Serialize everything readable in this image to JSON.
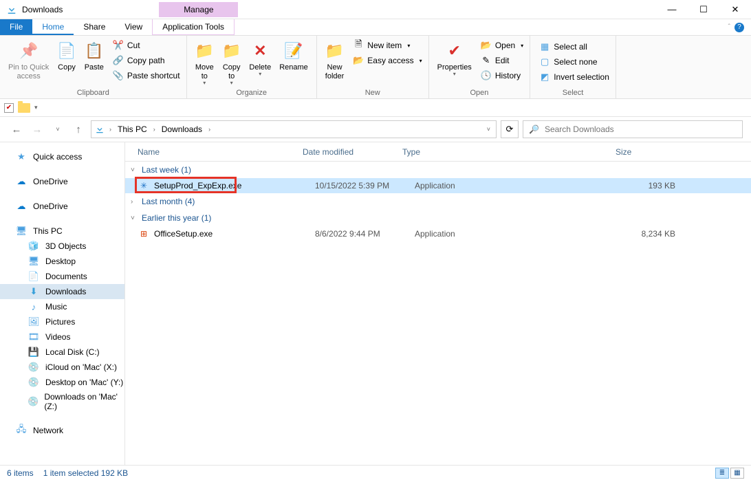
{
  "window": {
    "title": "Downloads",
    "manage_tab": "Manage"
  },
  "menutabs": {
    "file": "File",
    "home": "Home",
    "share": "Share",
    "view": "View",
    "apptools": "Application Tools"
  },
  "ribbon": {
    "clipboard": {
      "label": "Clipboard",
      "pin": "Pin to Quick\naccess",
      "copy": "Copy",
      "paste": "Paste",
      "cut": "Cut",
      "copypath": "Copy path",
      "pasteshortcut": "Paste shortcut"
    },
    "organize": {
      "label": "Organize",
      "moveto": "Move\nto",
      "copyto": "Copy\nto",
      "delete": "Delete",
      "rename": "Rename"
    },
    "new": {
      "label": "New",
      "newfolder": "New\nfolder",
      "newitem": "New item",
      "easyaccess": "Easy access"
    },
    "open": {
      "label": "Open",
      "properties": "Properties",
      "open": "Open",
      "edit": "Edit",
      "history": "History"
    },
    "select": {
      "label": "Select",
      "selectall": "Select all",
      "selectnone": "Select none",
      "invert": "Invert selection"
    }
  },
  "addressbar": {
    "crumbs": [
      "This PC",
      "Downloads"
    ],
    "search_placeholder": "Search Downloads"
  },
  "navpane": {
    "quickaccess": "Quick access",
    "onedrive1": "OneDrive",
    "onedrive2": "OneDrive",
    "thispc": "This PC",
    "items": [
      "3D Objects",
      "Desktop",
      "Documents",
      "Downloads",
      "Music",
      "Pictures",
      "Videos",
      "Local Disk (C:)",
      "iCloud on 'Mac' (X:)",
      "Desktop on 'Mac' (Y:)",
      "Downloads on 'Mac' (Z:)"
    ],
    "network": "Network"
  },
  "columns": {
    "name": "Name",
    "date": "Date modified",
    "type": "Type",
    "size": "Size"
  },
  "groups": [
    {
      "title": "Last week (1)",
      "expanded": true,
      "files": [
        {
          "icon": "setup",
          "name": "SetupProd_ExpExp.exe",
          "date": "10/15/2022 5:39 PM",
          "type": "Application",
          "size": "193 KB",
          "selected": true,
          "highlighted": true
        }
      ]
    },
    {
      "title": "Last month (4)",
      "expanded": false,
      "files": []
    },
    {
      "title": "Earlier this year (1)",
      "expanded": true,
      "files": [
        {
          "icon": "office",
          "name": "OfficeSetup.exe",
          "date": "8/6/2022 9:44 PM",
          "type": "Application",
          "size": "8,234 KB",
          "selected": false
        }
      ]
    }
  ],
  "statusbar": {
    "items": "6 items",
    "selected": "1 item selected  192 KB"
  }
}
